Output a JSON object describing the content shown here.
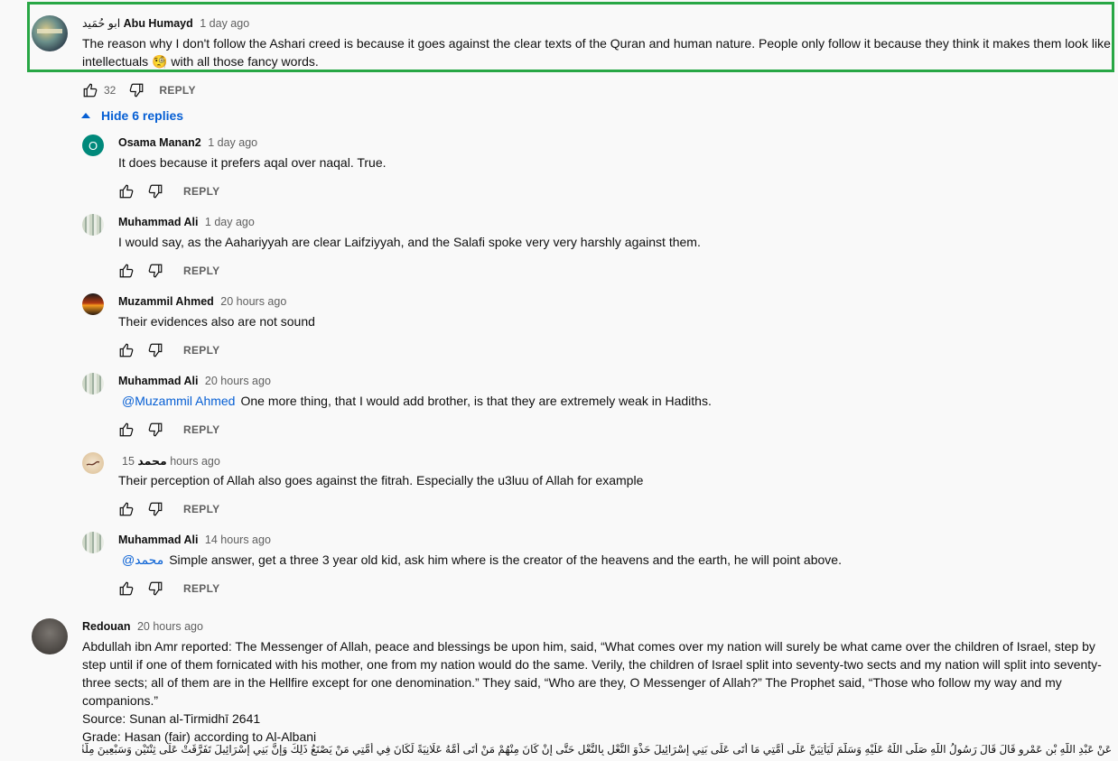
{
  "top_comment": {
    "author_arabic": "ابو حُمَيد",
    "author": "Abu Humayd",
    "time": "1 day ago",
    "text_line1": "The reason why I don't follow the Ashari creed is because it goes against the clear texts of the Quran and human nature. People only follow it because they think it makes them look like",
    "text_line2_a": "intellectuals",
    "emoji": "🧐",
    "text_line2_b": "with all those fancy words.",
    "likes": "32",
    "reply_label": "REPLY"
  },
  "replies_toggle": {
    "label": "Hide 6 replies"
  },
  "replies": [
    {
      "author": "Osama Manan2",
      "time": "1 day ago",
      "text": "It does because it prefers aqal over naqal. True.",
      "avatar_letter": "O",
      "reply_label": "REPLY"
    },
    {
      "author": "Muhammad Ali",
      "time": "1 day ago",
      "text": "I would say, as the Aahariyyah are clear Laifziyyah, and the Salafi spoke very very harshly against them.",
      "reply_label": "REPLY"
    },
    {
      "author": "Muzammil Ahmed",
      "time": "20 hours ago",
      "text": "Their evidences also are not sound",
      "reply_label": "REPLY"
    },
    {
      "author": "Muhammad Ali",
      "time": "20 hours ago",
      "mention": "@Muzammil Ahmed",
      "text": "One more thing, that I would add brother, is that they are extremely weak in Hadiths.",
      "reply_label": "REPLY"
    },
    {
      "author": "محمد",
      "time": "15 hours ago",
      "text": "Their perception of Allah also goes against the fitrah. Especially the u3luu of Allah for example",
      "reply_label": "REPLY"
    },
    {
      "author": "Muhammad Ali",
      "time": "14 hours ago",
      "mention": "@محمد",
      "text": "Simple answer, get a three 3 year old kid, ask him where is the creator of the heavens and the earth, he will point above.",
      "reply_label": "REPLY"
    }
  ],
  "bottom_comment": {
    "author": "Redouan",
    "time": "20 hours ago",
    "lines": [
      "Abdullah ibn Amr reported: The Messenger of Allah, peace and blessings be upon him, said, “What comes over my nation will surely be what came over the children of Israel, step by",
      "step until if one of them fornicated with his mother, one from my nation would do the same. Verily, the children of Israel split into seventy-two sects and my nation will split into seventy-",
      "three sects; all of them are in the Hellfire except for one denomination.” They said, “Who are they, O Messenger of Allah?” The Prophet said, “Those who follow my way and my",
      "companions.”",
      "Source: Sunan al-Tirmidhī 2641",
      "Grade: Hasan (fair) according to Al-Albani"
    ],
    "arabic_line": "عَنْ عَبْدِ اللَّهِ بْنِ عَمْرٍو قَالَ قَالَ رَسُولُ اللَّهِ صَلَّى اللَّهُ عَلَيْهِ وَسَلَّمَ لَيَأْتِيَنَّ عَلَى أُمَّتِي مَا أَتَى عَلَى بَنِي إِسْرَائِيلَ حَذْوَ النَّعْلِ بِالنَّعْلِ حَتَّى إِنْ كَانَ مِنْهُمْ مَنْ أَتَى أُمَّهُ عَلَانِيَةً لَكَانَ فِي أُمَّتِي مَنْ يَصْنَعُ ذَلِكَ وَإِنَّ بَنِي إِسْرَائِيلَ تَفَرَّقَتْ عَلَى ثِنْتَيْنِ وَسَبْعِينَ مِلَّةً وَتَفْتَرِقُ أُمَّتِي عَلَى ثَلَاثٍ"
  },
  "colors": {
    "link": "#065fd4",
    "highlight": "#28a745",
    "meta": "#606060",
    "background": "#f9f9f9"
  },
  "icons": {
    "like": "thumbs-up-icon",
    "dislike": "thumbs-down-icon",
    "collapse": "triangle-up-icon"
  }
}
